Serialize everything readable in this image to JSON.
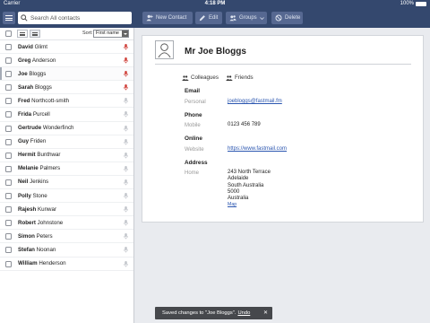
{
  "status": {
    "carrier": "Carrier",
    "time": "4:18 PM",
    "battery": "100%"
  },
  "toolbar": {
    "search_placeholder": "Search All contacts",
    "new_contact": "New Contact",
    "edit": "Edit",
    "groups": "Groups",
    "delete": "Delete"
  },
  "list": {
    "sort_label": "Sort:",
    "sort_value": "First name",
    "contacts": [
      {
        "first": "David",
        "last": "Glimt",
        "bold_first": false,
        "selected": false,
        "mic_active": true
      },
      {
        "first": "Greg",
        "last": "Anderson",
        "bold_first": false,
        "selected": false,
        "mic_active": true
      },
      {
        "first": "Joe",
        "last": "Bloggs",
        "bold_first": true,
        "selected": true,
        "mic_active": true
      },
      {
        "first": "Sarah",
        "last": "Bloggs",
        "bold_first": false,
        "selected": false,
        "mic_active": true
      },
      {
        "first": "Fred",
        "last": "Northcott-smith",
        "bold_first": false,
        "selected": false,
        "mic_active": false
      },
      {
        "first": "Frida",
        "last": "Purcell",
        "bold_first": false,
        "selected": false,
        "mic_active": false
      },
      {
        "first": "Gertrude",
        "last": "Wonderfinch",
        "bold_first": false,
        "selected": false,
        "mic_active": false
      },
      {
        "first": "Guy",
        "last": "Friden",
        "bold_first": false,
        "selected": false,
        "mic_active": false
      },
      {
        "first": "Hermit",
        "last": "Bunthwar",
        "bold_first": false,
        "selected": false,
        "mic_active": false
      },
      {
        "first": "Melanie",
        "last": "Palmers",
        "bold_first": false,
        "selected": false,
        "mic_active": false
      },
      {
        "first": "Neil",
        "last": "Jenkins",
        "bold_first": false,
        "selected": false,
        "mic_active": false
      },
      {
        "first": "Polly",
        "last": "Stone",
        "bold_first": false,
        "selected": false,
        "mic_active": false
      },
      {
        "first": "Rajesh",
        "last": "Kunwar",
        "bold_first": false,
        "selected": false,
        "mic_active": false
      },
      {
        "first": "Robert",
        "last": "Johnstone",
        "bold_first": false,
        "selected": false,
        "mic_active": false
      },
      {
        "first": "Simon",
        "last": "Peters",
        "bold_first": false,
        "selected": false,
        "mic_active": false
      },
      {
        "first": "Stefan",
        "last": "Noonan",
        "bold_first": false,
        "selected": false,
        "mic_active": false
      },
      {
        "first": "William",
        "last": "Henderson",
        "bold_first": false,
        "selected": false,
        "mic_active": false
      }
    ]
  },
  "contact": {
    "name": "Mr Joe Bloggs",
    "groups": [
      "Colleagues",
      "Friends"
    ],
    "email_heading": "Email",
    "email_label": "Personal",
    "email_value": "joebloggs@fastmail.fm",
    "phone_heading": "Phone",
    "phone_label": "Mobile",
    "phone_value": "0123 456 789",
    "online_heading": "Online",
    "online_label": "Website",
    "online_value": "https://www.fastmail.com",
    "address_heading": "Address",
    "address_label": "Home",
    "address_lines": [
      "243 North Terrace",
      "Adelaide",
      "South Australia",
      "5000",
      "Australia"
    ],
    "map_link": "Map"
  },
  "toast": {
    "message": "Saved changes to \"Joe Bloggs\".",
    "undo": "Undo",
    "close": "✕"
  },
  "colors": {
    "toolbar_bg": "#34486e",
    "button_bg": "#566891",
    "mic_active": "#d0433c",
    "mic_inactive": "#c3c6cc",
    "link": "#2b56b0"
  }
}
